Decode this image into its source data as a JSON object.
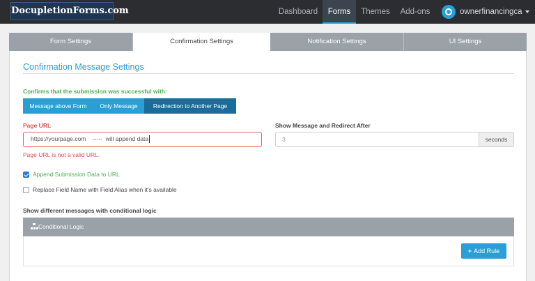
{
  "brand": {
    "name": "DocupletionForms.com"
  },
  "nav": {
    "items": [
      {
        "label": "Dashboard"
      },
      {
        "label": "Forms"
      },
      {
        "label": "Themes"
      },
      {
        "label": "Add-ons"
      }
    ],
    "active": "Forms",
    "user": {
      "name": "ownerfinancingca",
      "icon": "power-icon"
    }
  },
  "tabs": {
    "items": [
      {
        "label": "Form Settings"
      },
      {
        "label": "Confirmation Settings"
      },
      {
        "label": "Notification Settings"
      },
      {
        "label": "UI Settings"
      }
    ],
    "active": "Confirmation Settings"
  },
  "confirmation": {
    "title": "Confirmation Message Settings",
    "confirm_label": "Confirms that the submission was successful with:",
    "options": [
      {
        "label": "Message above Form"
      },
      {
        "label": "Only Message"
      },
      {
        "label": "Redirection to Another Page"
      }
    ],
    "selected_option": "Redirection to Another Page",
    "page_url": {
      "label": "Page URL",
      "value": "https://yourpage.com    -----  will append data",
      "error": "Page URL is not a valid URL."
    },
    "redirect_after": {
      "label": "Show Message and Redirect After",
      "placeholder": "3",
      "unit": "seconds"
    },
    "checkboxes": [
      {
        "label": "Append Submission Data to URL",
        "checked": true
      },
      {
        "label": "Replace Field Name with Field Alias when it's available",
        "checked": false
      }
    ]
  },
  "conditional": {
    "label": "Show different messages with conditional logic",
    "panel_title": "Conditional Logic",
    "panel_icon": "sitemap-icon",
    "add_rule_label": "Add Rule"
  },
  "colors": {
    "accent": "#2a9fd6",
    "nav_bg": "#2b2d31",
    "success": "#4caf50",
    "error": "#d9534f",
    "tab_inactive": "#9aa1a9"
  }
}
